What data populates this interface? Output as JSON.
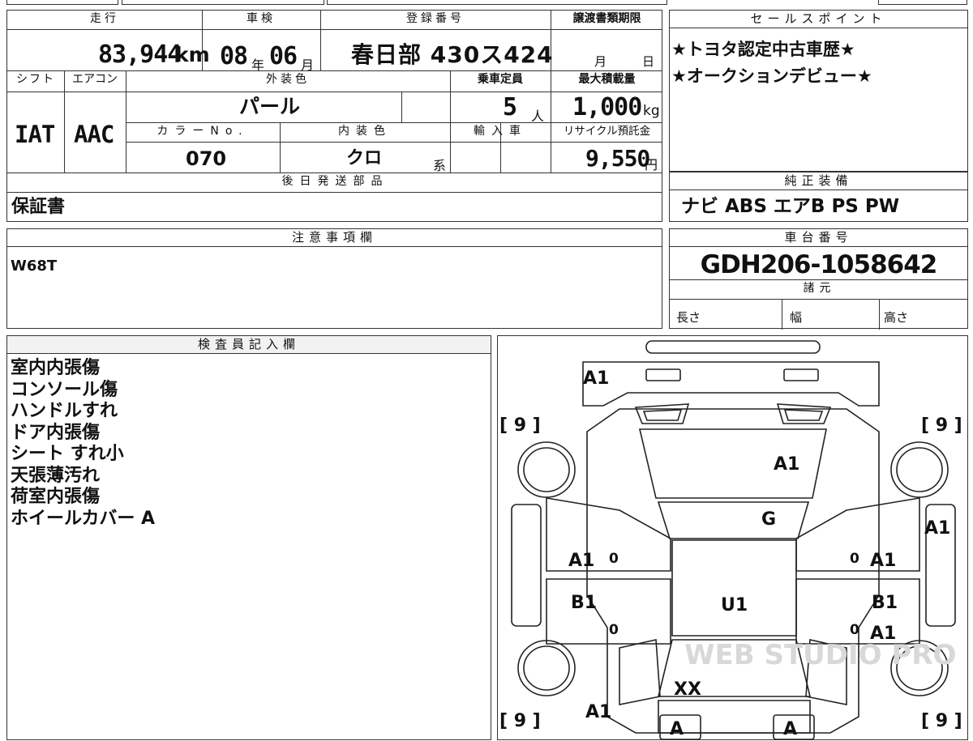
{
  "spec": {
    "mileage": {
      "label": "走行",
      "value": "83,944",
      "unit": "km"
    },
    "shaken": {
      "label": "車検",
      "year": "08",
      "year_unit": "年",
      "month": "06",
      "month_unit": "月"
    },
    "registration": {
      "label": "登録番号",
      "value": "春日部 430ス424"
    },
    "transfer_deadline": {
      "label": "譲渡書類期限",
      "month": "月",
      "day": "日"
    },
    "shift": {
      "label": "シフト",
      "value": "IAT"
    },
    "aircon": {
      "label": "エアコン",
      "value": "AAC"
    },
    "exterior_color": {
      "label": "外装色",
      "value": "パール"
    },
    "capacity": {
      "label": "乗車定員",
      "value": "5",
      "unit": "人"
    },
    "max_load": {
      "label": "最大積載量",
      "value": "1,000",
      "unit": "kg"
    },
    "color_no": {
      "label": "カラーNo.",
      "value": "070"
    },
    "interior_color": {
      "label": "内装色",
      "value": "クロ",
      "suffix": "系"
    },
    "import": {
      "label": "輸入車",
      "value": ""
    },
    "recycle_fee": {
      "label": "リサイクル預託金",
      "value": "9,550",
      "unit": "円"
    },
    "later_parts": {
      "label": "後日発送部品",
      "value": "保証書"
    }
  },
  "sales_points": {
    "label": "セールスポイント",
    "lines": [
      "★トヨタ認定中古車歴★",
      "★オークションデビュー★"
    ]
  },
  "equipment": {
    "label": "純正装備",
    "value": "ナビ ABS エアB PS PW"
  },
  "notes": {
    "label": "注意事項欄",
    "value": "W68T"
  },
  "chassis": {
    "label": "車台番号",
    "value": "GDH206-1058642"
  },
  "dimensions": {
    "label": "諸元",
    "length": "長さ",
    "width": "幅",
    "height": "高さ"
  },
  "inspector": {
    "label": "検査員記入欄",
    "items": [
      "室内内張傷",
      "コンソール傷",
      "ハンドルすれ",
      "ドア内張傷",
      "シート すれ小",
      "天張薄汚れ",
      "荷室内張傷",
      "ホイールカバー A"
    ]
  },
  "diagram": {
    "tire_marks": [
      "[ 9 ]",
      "[ 9 ]",
      "[ 9 ]",
      "[ 9 ]"
    ],
    "marks": {
      "front_bumper": "A1",
      "hood": "A1",
      "windshield": "G",
      "roof": "U1",
      "rear_glass": "XX",
      "left_fender": "A1",
      "left_front_door": "A1",
      "left_rear_door": "B1",
      "left_quarter": "A1",
      "right_fender": "A1",
      "right_front_door": "A1",
      "right_rear_door": "B1",
      "right_rear": "A1",
      "rear_left": "A",
      "rear_right": "A"
    },
    "zeros": [
      "0",
      "0",
      "0",
      "0"
    ]
  },
  "watermark": "WEB STUDIO PRO"
}
